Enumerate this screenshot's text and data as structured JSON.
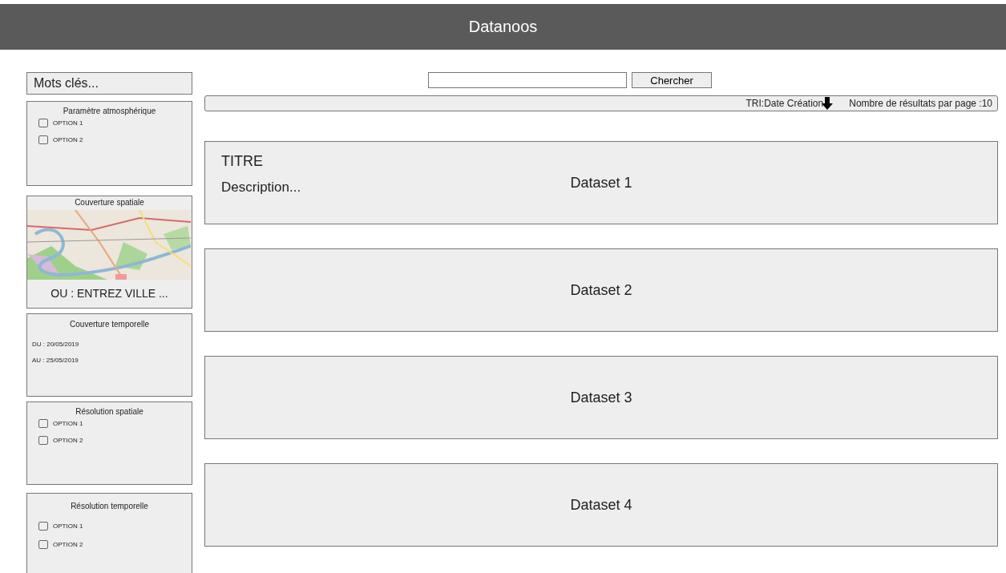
{
  "header": {
    "title": "Datanoos"
  },
  "sidebar": {
    "keyword_field": {
      "placeholder": "Mots clés..."
    },
    "filters": [
      {
        "kind": "checkboxes",
        "title": "Paramètre atmosphérique",
        "options": [
          {
            "label": "OPTION 1",
            "checked": false
          },
          {
            "label": "OPTION 2",
            "checked": false
          }
        ]
      },
      {
        "kind": "map",
        "title": "Couverture spatiale",
        "city_field": {
          "placeholder": "OU : ENTREZ VILLE ..."
        }
      },
      {
        "kind": "dates",
        "title": "Couverture temporelle",
        "from": "DU : 20/05/2019",
        "to": "AU : 25/05/2019"
      },
      {
        "kind": "checkboxes",
        "title": "Résolution spatiale",
        "options": [
          {
            "label": "OPTION 1",
            "checked": false
          },
          {
            "label": "OPTION 2",
            "checked": false
          }
        ]
      },
      {
        "kind": "checkboxes",
        "title": "Résolution temporelle",
        "options": [
          {
            "label": "OPTION 1",
            "checked": false
          },
          {
            "label": "OPTION 2",
            "checked": false
          }
        ]
      }
    ]
  },
  "search": {
    "button": "Chercher"
  },
  "sort_bar": {
    "sort": "TRI:Date Création",
    "results_per_page": "Nombre de résultats par page :10"
  },
  "datasets": [
    {
      "title": "TITRE",
      "description": "Description...",
      "label": "Dataset 1"
    },
    {
      "label": "Dataset 2"
    },
    {
      "label": "Dataset 3"
    },
    {
      "label": "Dataset 4"
    }
  ]
}
